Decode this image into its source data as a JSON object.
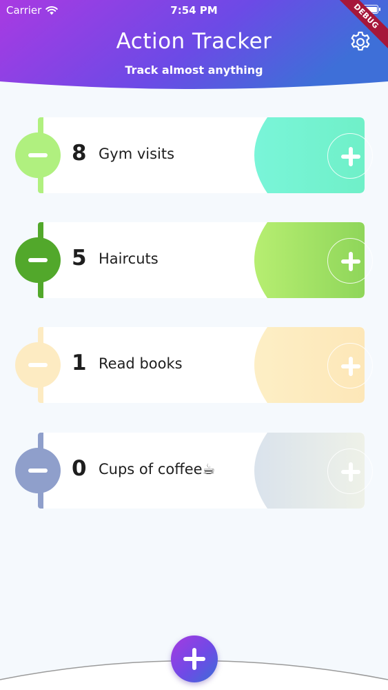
{
  "status_bar": {
    "carrier": "Carrier",
    "time": "7:54 PM"
  },
  "header": {
    "title": "Action Tracker",
    "subtitle": "Track almost anything",
    "debug_label": "DEBUG",
    "gradient": [
      "#a93ae2",
      "#6c4ae6",
      "#3e6fd8"
    ]
  },
  "actions": [
    {
      "count": "8",
      "label": "Gym visits",
      "accent": "#b0f07f",
      "wave_from": "#7af5d9",
      "wave_to": "#6ff0c8"
    },
    {
      "count": "5",
      "label": "Haircuts",
      "accent": "#52a82b",
      "wave_from": "#b8ef72",
      "wave_to": "#8fd65a"
    },
    {
      "count": "1",
      "label": "Read books",
      "accent": "#fdebc2",
      "wave_from": "#fdefc6",
      "wave_to": "#fde7b8"
    },
    {
      "count": "0",
      "label": "Cups of coffee☕",
      "accent": "#8f9fcb",
      "wave_from": "#d9e2ec",
      "wave_to": "#eef1e8"
    }
  ],
  "icons": {
    "settings": "gear-icon",
    "wifi": "wifi-icon",
    "battery": "battery-icon",
    "add": "plus-icon",
    "remove": "minus-icon"
  }
}
